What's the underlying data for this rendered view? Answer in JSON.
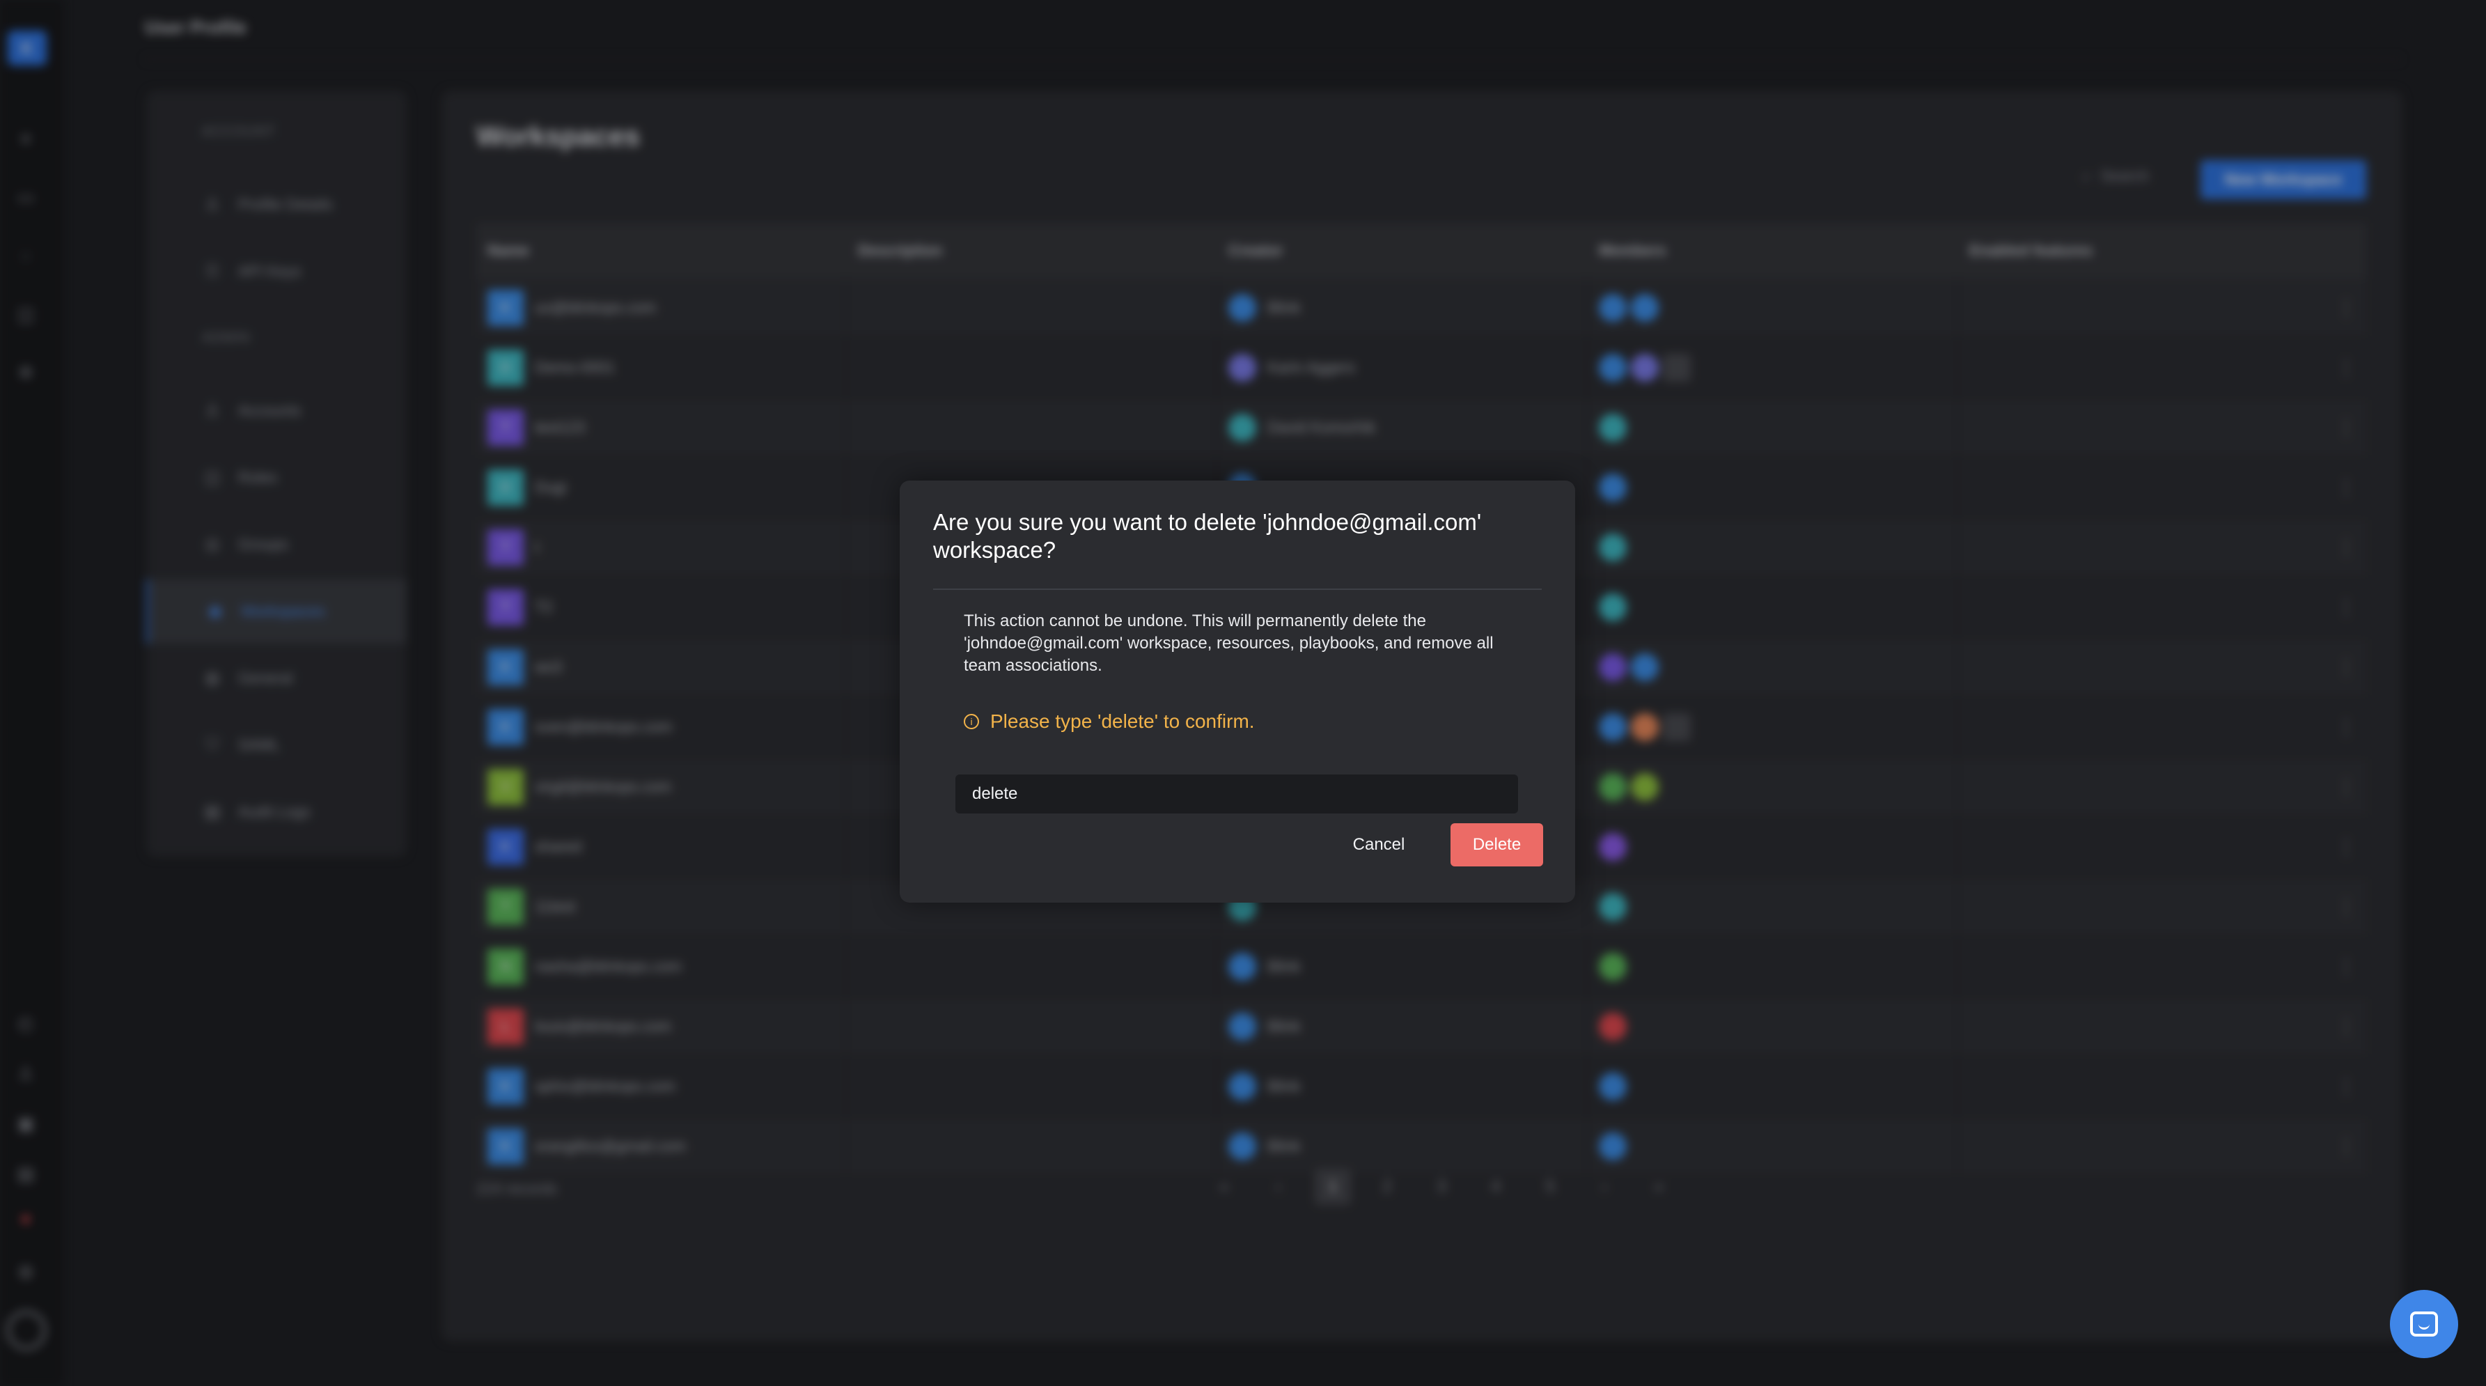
{
  "page": {
    "title": "User Profile",
    "brand_initial": "K"
  },
  "rail_icons": [
    "list-icon",
    "calendar-icon",
    "chat-icon",
    "bag-icon",
    "gear-icon",
    "clock-icon",
    "user-icon",
    "box-icon",
    "doc-icon",
    "alert-icon",
    "settings-icon"
  ],
  "settings_nav": {
    "sections": [
      {
        "label": "ACCOUNT",
        "items": [
          {
            "label": "Profile Details",
            "icon": "user-icon"
          },
          {
            "label": "API Keys",
            "icon": "key-icon"
          }
        ]
      },
      {
        "label": "ADMIN",
        "items": [
          {
            "label": "Accounts",
            "icon": "user-icon"
          },
          {
            "label": "Roles",
            "icon": "briefcase-icon"
          },
          {
            "label": "Groups",
            "icon": "group-icon"
          },
          {
            "label": "Workspaces",
            "icon": "workspace-icon",
            "active": true
          },
          {
            "label": "General",
            "icon": "gear-icon"
          },
          {
            "label": "SAML",
            "icon": "shield-icon"
          },
          {
            "label": "Audit Logs",
            "icon": "log-icon"
          }
        ]
      }
    ]
  },
  "workspaces": {
    "title": "Workspaces",
    "search_label": "Search",
    "new_button": "New Workspace",
    "columns": [
      "Name",
      "Description",
      "Creator",
      "Members",
      "Enabled features"
    ],
    "rows": [
      {
        "initial": "K",
        "color": "#3d8ee8",
        "name": "ux@blinkops.com",
        "creator": "Blink",
        "creator_color": "#3d8ee8",
        "members": [
          "#3d8ee8",
          "#3d8ee8"
        ],
        "more": false
      },
      {
        "initial": "D",
        "color": "#3fb9c4",
        "name": "Demo-0001",
        "creator": "Karin Aggers",
        "creator_color": "#7a7be8",
        "members": [
          "#3d8ee8",
          "#7a7be8"
        ],
        "more": true
      },
      {
        "initial": "T",
        "color": "#7a5be8",
        "name": "test123",
        "creator": "David Komorhik",
        "creator_color": "#3fb9c4",
        "members": [
          "#3fb9c4"
        ],
        "more": false
      },
      {
        "initial": "D",
        "color": "#3fb9c4",
        "name": "Dugi",
        "creator": "",
        "creator_color": "#3d8ee8",
        "members": [
          "#3d8ee8"
        ],
        "more": false
      },
      {
        "initial": "T",
        "color": "#7a5be8",
        "name": "t",
        "creator": "",
        "creator_color": "",
        "members": [
          "#3fb9c4"
        ],
        "more": false
      },
      {
        "initial": "T",
        "color": "#7a5be8",
        "name": "T2",
        "creator": "",
        "creator_color": "",
        "members": [
          "#3fb9c4"
        ],
        "more": false
      },
      {
        "initial": "K",
        "color": "#3d8ee8",
        "name": "ws3",
        "creator": "",
        "creator_color": "",
        "members": [
          "#7a5be8",
          "#3d8ee8"
        ],
        "more": false
      },
      {
        "initial": "K",
        "color": "#3d8ee8",
        "name": "sven@blinkops.com",
        "creator": "",
        "creator_color": "",
        "members": [
          "#3d8ee8",
          "#e8885b"
        ],
        "more": true
      },
      {
        "initial": "V",
        "color": "#8fc23f",
        "name": "virgil@blinkops.com",
        "creator": "",
        "creator_color": "",
        "members": [
          "#5bb85b",
          "#8fc23f"
        ],
        "more": false
      },
      {
        "initial": "K",
        "color": "#3d6ee8",
        "name": "shared",
        "creator": "",
        "creator_color": "",
        "members": [
          "#8a5be8"
        ],
        "more": false
      },
      {
        "initial": "T",
        "color": "#5bb85b",
        "name": "11test",
        "creator": "",
        "creator_color": "#3fb9c4",
        "members": [
          "#3fb9c4"
        ],
        "more": false
      },
      {
        "initial": "N",
        "color": "#5bb85b",
        "name": "nasha@blinkops.com",
        "creator": "Blink",
        "creator_color": "#3d8ee8",
        "members": [
          "#5bb85b"
        ],
        "more": false
      },
      {
        "initial": "L",
        "color": "#e0484f",
        "name": "louis@blinkops.com",
        "creator": "Blink",
        "creator_color": "#3d8ee8",
        "members": [
          "#e0484f"
        ],
        "more": false
      },
      {
        "initial": "K",
        "color": "#3d8ee8",
        "name": "sphix@blinkops.com",
        "creator": "Blink",
        "creator_color": "#3d8ee8",
        "members": [
          "#3d8ee8"
        ],
        "more": false
      },
      {
        "initial": "K",
        "color": "#3d8ee8",
        "name": "orangillos@gmail.com",
        "creator": "Blink",
        "creator_color": "#3d8ee8",
        "members": [
          "#3d8ee8"
        ],
        "more": false
      }
    ],
    "records_label": "224 records",
    "pagination": {
      "pages": [
        "1",
        "2",
        "3",
        "4",
        "5"
      ],
      "current": "1",
      "first": "«",
      "prev": "‹",
      "next": "›",
      "last": "»"
    }
  },
  "modal": {
    "title": "Are you sure you want to delete 'johndoe@gmail.com' workspace?",
    "body": "This action cannot be undone. This will permanently delete the 'johndoe@gmail.com' workspace, resources, playbooks, and remove all team associations.",
    "warning": "Please type 'delete' to confirm.",
    "input_value": "delete",
    "cancel_label": "Cancel",
    "delete_label": "Delete",
    "delete_color": "#ec6b66",
    "warning_color": "#f2b34a"
  },
  "chat_button": {
    "icon": "chat-icon"
  }
}
